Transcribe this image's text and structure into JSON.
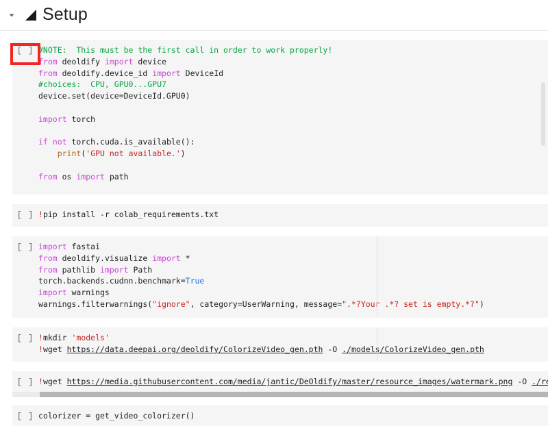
{
  "header": {
    "collapse_icon": "caret-down-icon",
    "section_icon": "filled-triangle-icon",
    "title": "Setup"
  },
  "notebook": {
    "run_button_label": "[ ]",
    "cells": [
      {
        "id": "cell-device-setup",
        "run_label": "[ ]",
        "highlighted": true,
        "has_vertical_scrollbar": true,
        "lines": [
          "#NOTE:  This must be the first call in order to work properly!",
          "from deoldify import device",
          "from deoldify.device_id import DeviceId",
          "#choices:  CPU, GPU0...GPU7",
          "device.set(device=DeviceId.GPU0)",
          "",
          "import torch",
          "",
          "if not torch.cuda.is_available():",
          "    print('GPU not available.')",
          "",
          "from os import path"
        ]
      },
      {
        "id": "cell-pip-install",
        "run_label": "[ ]",
        "lines": [
          "!pip install -r colab_requirements.txt"
        ]
      },
      {
        "id": "cell-imports",
        "run_label": "[ ]",
        "has_ruler": true,
        "lines": [
          "import fastai",
          "from deoldify.visualize import *",
          "from pathlib import Path",
          "torch.backends.cudnn.benchmark=True",
          "import warnings",
          "warnings.filterwarnings(\".*?Your .*? set is empty.*?\")"
        ]
      },
      {
        "id": "cell-download-model",
        "run_label": "[ ]",
        "has_ruler": true,
        "lines": [
          "!mkdir 'models'",
          "!wget https://data.deepai.org/deoldify/ColorizeVideo_gen.pth -O ./models/ColorizeVideo_gen.pth"
        ]
      },
      {
        "id": "cell-download-watermark",
        "run_label": "[ ]",
        "has_horizontal_scrollbar": true,
        "lines": [
          "!wget https://media.githubusercontent.com/media/jantic/DeOldify/master/resource_images/watermark.png -O ./resource_imag"
        ]
      },
      {
        "id": "cell-colorizer",
        "run_label": "[ ]",
        "lines": [
          "colorizer = get_video_colorizer()"
        ]
      }
    ]
  },
  "code_text": {
    "c1_l1": "#NOTE:  This must be the first call in order to work properly!",
    "c1_l2_kw": "from",
    "c1_l2_mod": " deoldify ",
    "c1_l2_kw2": "import",
    "c1_l2_rest": " device",
    "c1_l3_kw": "from",
    "c1_l3_mod": " deoldify.device_id ",
    "c1_l3_kw2": "import",
    "c1_l3_rest": " DeviceId",
    "c1_l4": "#choices:  CPU, GPU0...GPU7",
    "c1_l5": "device.set(device=DeviceId.GPU0)",
    "c1_l7_kw": "import",
    "c1_l7_rest": " torch",
    "c1_l9_if": "if",
    "c1_l9_not": " not",
    "c1_l9_rest": " torch.cuda.is_available():",
    "c1_l10_indent": "    ",
    "c1_l10_print": "print",
    "c1_l10_open": "(",
    "c1_l10_str": "'GPU not available.'",
    "c1_l10_close": ")",
    "c1_l12_kw": "from",
    "c1_l12_mod": " os ",
    "c1_l12_kw2": "import",
    "c1_l12_rest": " path",
    "c2_bang": "!",
    "c2_rest": "pip install -r colab_requirements.txt",
    "c3_l1_kw": "import",
    "c3_l1_rest": " fastai",
    "c3_l2_kw": "from",
    "c3_l2_mod": " deoldify.visualize ",
    "c3_l2_kw2": "import",
    "c3_l2_rest": " *",
    "c3_l3_kw": "from",
    "c3_l3_mod": " pathlib ",
    "c3_l3_kw2": "import",
    "c3_l3_rest": " Path",
    "c3_l4_a": "torch.backends.cudnn.benchmark=",
    "c3_l4_true": "True",
    "c3_l5_kw": "import",
    "c3_l5_rest": " warnings",
    "c3_l6_a": "warnings.filterwarnings(",
    "c3_l6_s1": "\"ignore\"",
    "c3_l6_b": ", category=UserWarning, message=",
    "c3_l6_s2": "\".*?Your .*? set is empty.*?\"",
    "c3_l6_c": ")",
    "c4_l1_bang": "!",
    "c4_l1_cmd": "mkdir ",
    "c4_l1_str": "'models'",
    "c4_l2_bang": "!",
    "c4_l2_cmd": "wget ",
    "c4_l2_url": "https://data.deepai.org/deoldify/ColorizeVideo_gen.pth",
    "c4_l2_mid": " -O ",
    "c4_l2_path": "./models/ColorizeVideo_gen.pth",
    "c5_bang": "!",
    "c5_cmd": "wget ",
    "c5_url": "https://media.githubusercontent.com/media/jantic/DeOldify/master/resource_images/watermark.png",
    "c5_mid": " -O ",
    "c5_path": "./resource_imag",
    "c6_line": "colorizer = get_video_colorizer()"
  },
  "colors": {
    "cell_background": "#f5f5f5",
    "page_background": "#ffffff",
    "keyword": "#cb43d9",
    "comment": "#00a640",
    "string": "#c5221f",
    "builtin": "#b5651d",
    "literal": "#1a73e8",
    "highlight_box": "#f4241f",
    "scrollbar_thumb": "#b5b5b5",
    "title_text": "#202124"
  }
}
